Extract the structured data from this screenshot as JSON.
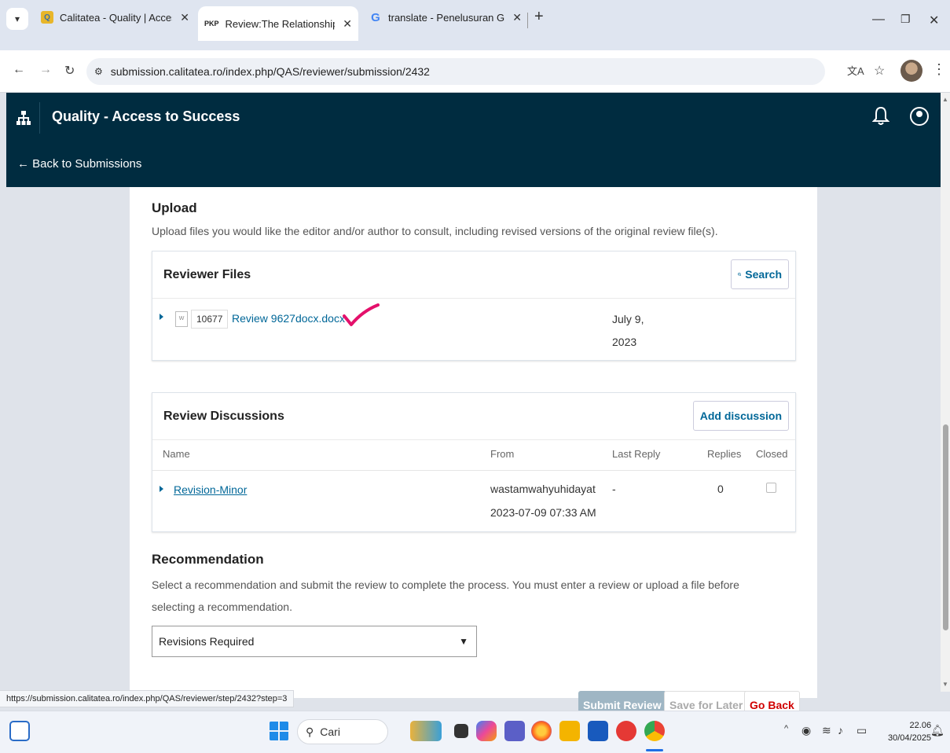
{
  "browser": {
    "tabs": [
      {
        "label": "Calitatea - Quality | Access to S",
        "favicon": "Q"
      },
      {
        "label": "Review:The Relationships betwe",
        "favicon": "PKP"
      },
      {
        "label": "translate - Penelusuran Google",
        "favicon": "G"
      }
    ],
    "url": "submission.calitatea.ro/index.php/QAS/reviewer/submission/2432",
    "status_url": "https://submission.calitatea.ro/index.php/QAS/reviewer/step/2432?step=3"
  },
  "app": {
    "title": "Quality - Access to Success",
    "back_label": "← Back to Submissions"
  },
  "upload": {
    "title": "Upload",
    "description": "Upload files you would like the editor and/or author to consult, including revised versions of the original review file(s)."
  },
  "reviewer_files": {
    "title": "Reviewer Files",
    "search_label": "Search",
    "files": [
      {
        "id": "10677",
        "name": "Review 9627docx.docx",
        "date_line1": "July 9,",
        "date_line2": "2023"
      }
    ]
  },
  "discussions": {
    "title": "Review Discussions",
    "add_label": "Add discussion",
    "columns": {
      "name": "Name",
      "from": "From",
      "last_reply": "Last Reply",
      "replies": "Replies",
      "closed": "Closed"
    },
    "rows": [
      {
        "name": "Revision-Minor",
        "from_user": "wastamwahyuhidayat",
        "from_date": "2023-07-09 07:33 AM",
        "last_reply": "-",
        "replies": "0"
      }
    ]
  },
  "recommendation": {
    "title": "Recommendation",
    "description": "Select a recommendation and submit the review to complete the process. You must enter a review or upload a file before selecting a recommendation.",
    "selected": "Revisions Required"
  },
  "actions": {
    "submit": "Submit Review",
    "save": "Save for Later",
    "back": "Go Back"
  },
  "taskbar": {
    "search_placeholder": "Cari",
    "time": "22.06",
    "date": "30/04/2025"
  },
  "colors": {
    "header_bg": "#002c40",
    "link": "#006798",
    "annotation": "#e4106b"
  }
}
